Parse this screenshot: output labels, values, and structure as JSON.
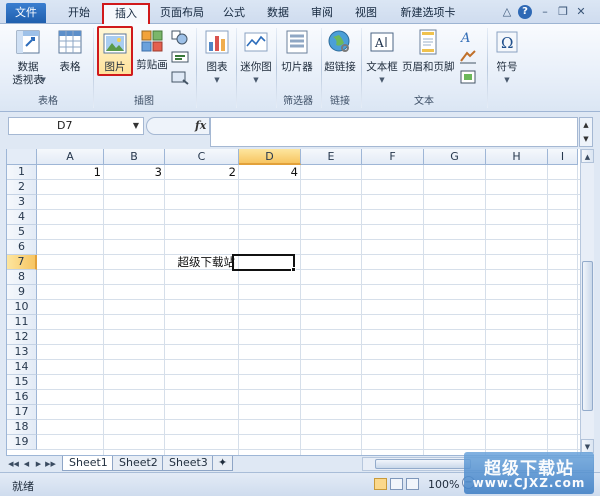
{
  "tabs": {
    "file": "文件",
    "home": "开始",
    "insert": "插入",
    "page_layout": "页面布局",
    "formulas": "公式",
    "data": "数据",
    "review": "审阅",
    "view": "视图",
    "new_tab": "新建选项卡"
  },
  "ribbon": {
    "groups": {
      "tables": "表格",
      "illustrations": "插图",
      "slicers": "筛选器",
      "links": "链接",
      "text": "文本"
    },
    "buttons": {
      "pivot_line1": "数据",
      "pivot_line2": "透视表",
      "table": "表格",
      "picture": "图片",
      "clipart": "剪贴画",
      "chart": "图表",
      "sparkline": "迷你图",
      "slicer": "切片器",
      "hyperlink": "超链接",
      "textbox": "文本框",
      "header_footer": "页眉和页脚",
      "symbol": "符号"
    }
  },
  "formula_bar": {
    "name_box": "D7",
    "fx": "fx",
    "value": ""
  },
  "grid": {
    "columns": [
      "A",
      "B",
      "C",
      "D",
      "E",
      "F",
      "G",
      "H",
      "I"
    ],
    "rows": [
      "1",
      "2",
      "3",
      "4",
      "5",
      "6",
      "7",
      "8",
      "9",
      "10",
      "11",
      "12",
      "13",
      "14",
      "15",
      "16",
      "17",
      "18",
      "19"
    ],
    "selected_column": "D",
    "selected_row": "7",
    "cells": {
      "A1": "1",
      "B1": "3",
      "C1": "2",
      "D1": "4",
      "C7": "超级下载站"
    }
  },
  "sheet_tabs": [
    "Sheet1",
    "Sheet2",
    "Sheet3"
  ],
  "active_sheet": "Sheet1",
  "status": {
    "ready": "就绪",
    "zoom": "100%"
  },
  "watermark": {
    "cn": "超级下载站",
    "en": "www.CJXZ.com"
  },
  "colors": {
    "highlight_box": "#d0191b",
    "selected_header": "#f7c562"
  }
}
